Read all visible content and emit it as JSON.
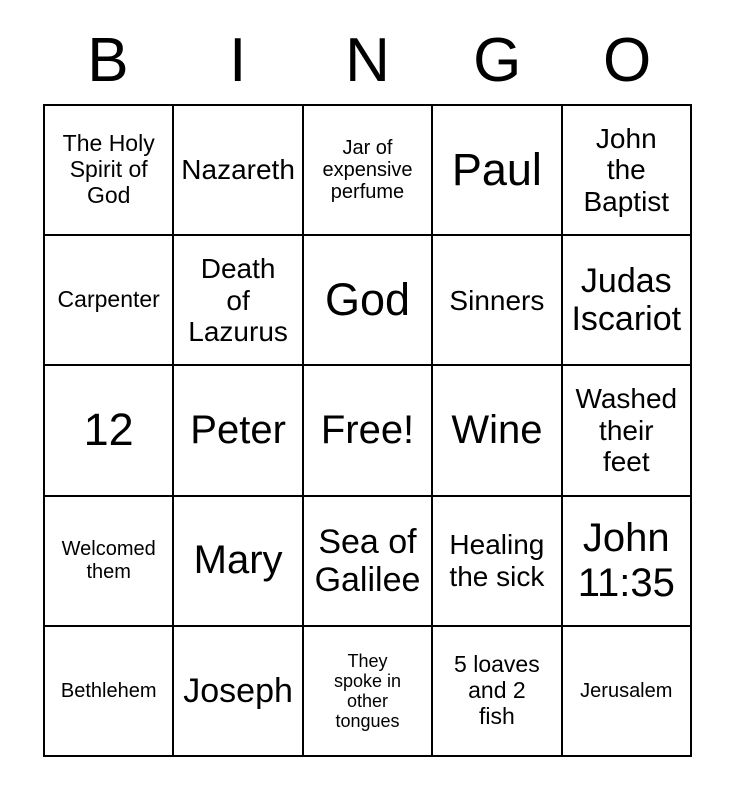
{
  "card": {
    "title": "BINGO",
    "header_letters": [
      "B",
      "I",
      "N",
      "G",
      "O"
    ],
    "free_space_label": "Free!",
    "colors": {
      "background": "#ffffff",
      "text": "#000000",
      "grid_line": "#000000"
    },
    "grid": {
      "columns": 5,
      "rows": 5,
      "cells": [
        {
          "text": "The Holy\nSpirit of\nGod",
          "size": "sm"
        },
        {
          "text": "Nazareth",
          "size": "md"
        },
        {
          "text": "Jar of\nexpensive\nperfume",
          "size": "xs"
        },
        {
          "text": "Paul",
          "size": "xxl"
        },
        {
          "text": "John\nthe\nBaptist",
          "size": "md"
        },
        {
          "text": "Carpenter",
          "size": "sm"
        },
        {
          "text": "Death\nof\nLazurus",
          "size": "md"
        },
        {
          "text": "God",
          "size": "xxl"
        },
        {
          "text": "Sinners",
          "size": "md"
        },
        {
          "text": "Judas\nIscariot",
          "size": "lg"
        },
        {
          "text": "12",
          "size": "xxl"
        },
        {
          "text": "Peter",
          "size": "xl"
        },
        {
          "text": "Free!",
          "size": "xl"
        },
        {
          "text": "Wine",
          "size": "xl"
        },
        {
          "text": "Washed\ntheir\nfeet",
          "size": "md"
        },
        {
          "text": "Welcomed\nthem",
          "size": "xs"
        },
        {
          "text": "Mary",
          "size": "xl"
        },
        {
          "text": "Sea of\nGalilee",
          "size": "lg"
        },
        {
          "text": "Healing\nthe sick",
          "size": "md"
        },
        {
          "text": "John\n11:35",
          "size": "xl"
        },
        {
          "text": "Bethlehem",
          "size": "xs"
        },
        {
          "text": "Joseph",
          "size": "lg"
        },
        {
          "text": "They\nspoke in\nother\ntongues",
          "size": "xxs"
        },
        {
          "text": "5 loaves\nand 2\nfish",
          "size": "sm"
        },
        {
          "text": "Jerusalem",
          "size": "xs"
        }
      ]
    }
  }
}
